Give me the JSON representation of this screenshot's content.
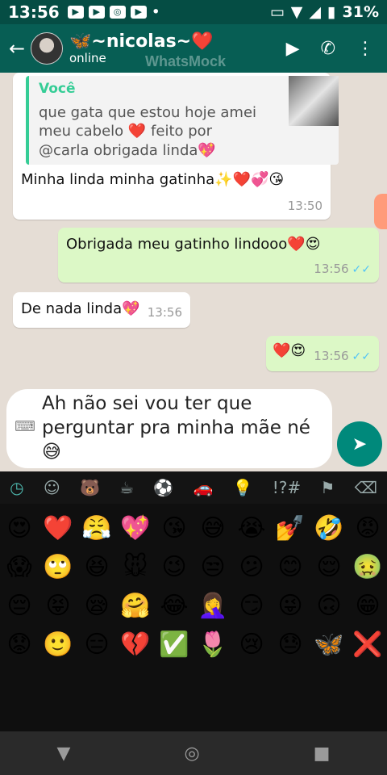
{
  "status_bar": {
    "time": "13:56",
    "battery": "31%"
  },
  "header": {
    "contact_name": "🦋~nicolas~❤️",
    "status": "online",
    "watermark": "WhatsMock"
  },
  "messages": [
    {
      "quote": {
        "author": "Você",
        "text": "que gata que estou hoje amei meu cabelo ❤️ feito por @carla obrigada linda💖"
      },
      "text": "Minha linda minha gatinha✨❤️💞😘",
      "time": "13:50"
    },
    {
      "text": "Obrigada meu gatinho lindooo❤️😍",
      "time": "13:56",
      "ticks": "✓✓"
    },
    {
      "text": "De nada linda💖",
      "time": "13:56"
    },
    {
      "text": "❤️😍",
      "time": "13:56",
      "ticks": "✓✓"
    }
  ],
  "input": {
    "text": "Ah não sei vou ter que perguntar pra minha mãe né 😅"
  },
  "emoji_categories": [
    "recent-icon",
    "smiley-icon",
    "animal-icon",
    "food-icon",
    "sport-icon",
    "car-icon",
    "bulb-icon",
    "symbols-icon",
    "flag-icon",
    "backspace-icon"
  ],
  "emoji_category_glyphs": [
    "◷",
    "☺",
    "🐻",
    "☕",
    "⚽",
    "🚗",
    "💡",
    "!?#",
    "⚑",
    "⌫"
  ],
  "emojis": [
    "😍",
    "❤️",
    "😤",
    "💖",
    "😘",
    "😅",
    "😭",
    "💅",
    "🤣",
    "😡",
    "😱",
    "🙄",
    "😆",
    "🐭",
    "😉",
    "😒",
    "😕",
    "😊",
    "😌",
    "🤢",
    "😔",
    "😝",
    "😪",
    "🤗",
    "😂",
    "🤦‍♀️",
    "😏",
    "😜",
    "🙃",
    "😁",
    "😟",
    "🙂",
    "😑",
    "💔",
    "✅",
    "🌷",
    "😢",
    "😓",
    "🦋",
    "❌"
  ]
}
